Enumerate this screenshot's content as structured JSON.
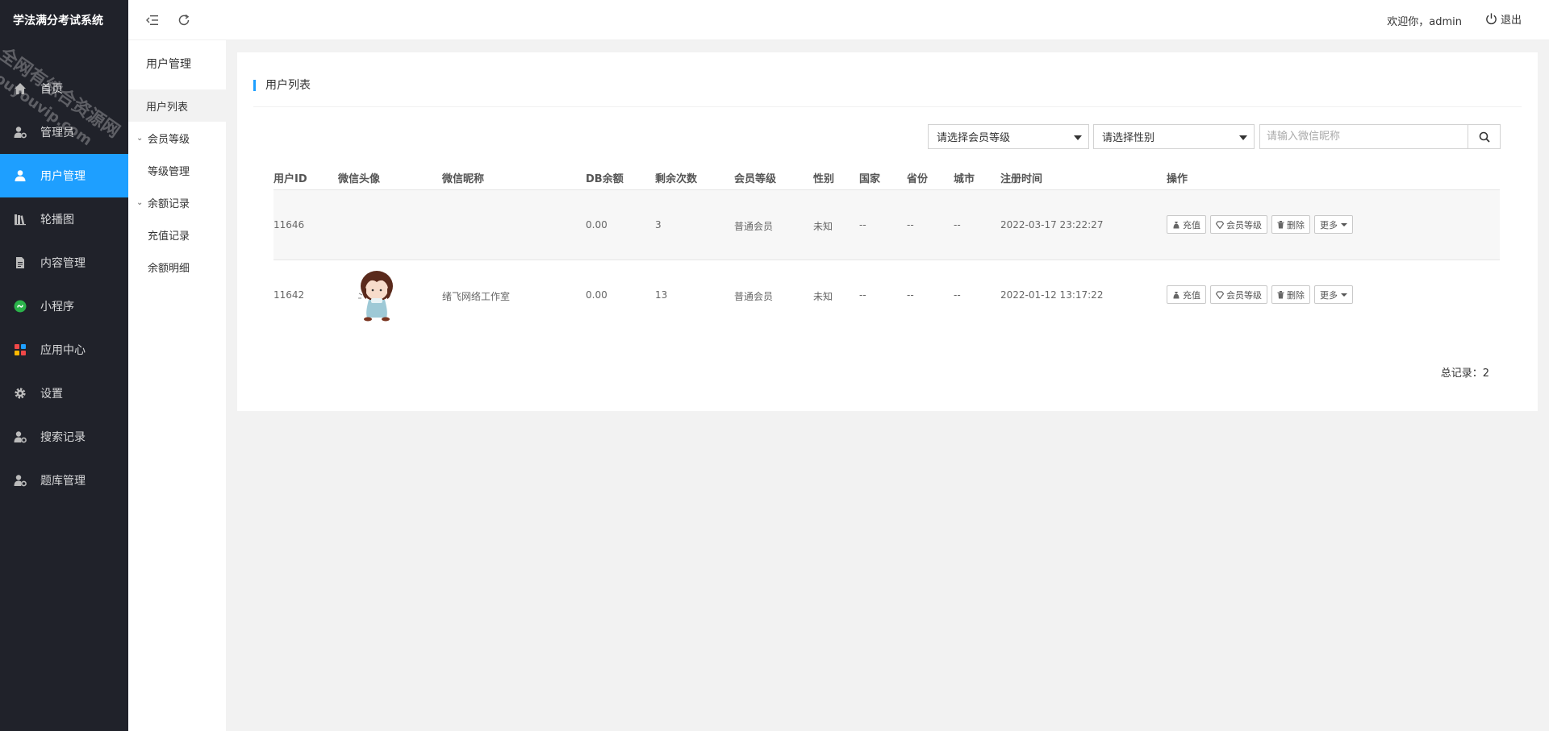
{
  "app": {
    "logo_text": "学法满分考试系统"
  },
  "watermark": {
    "line1": "全网有综合资源网",
    "line2": "douyouvip.com"
  },
  "sidebar": {
    "items": [
      {
        "label": "首页",
        "icon": "home-icon"
      },
      {
        "label": "管理员",
        "icon": "user-gear-icon"
      },
      {
        "label": "用户管理",
        "icon": "user-icon",
        "active": true
      },
      {
        "label": "轮播图",
        "icon": "carousel-icon"
      },
      {
        "label": "内容管理",
        "icon": "document-icon"
      },
      {
        "label": "小程序",
        "icon": "mini-program-icon"
      },
      {
        "label": "应用中心",
        "icon": "apps-icon"
      },
      {
        "label": "设置",
        "icon": "gear-icon"
      },
      {
        "label": "搜索记录",
        "icon": "user-gear-icon"
      },
      {
        "label": "题库管理",
        "icon": "user-gear-icon"
      }
    ]
  },
  "submenu": {
    "title": "用户管理",
    "items": [
      {
        "label": "用户列表",
        "active": true
      },
      {
        "label": "会员等级",
        "group": true
      },
      {
        "label": "等级管理"
      },
      {
        "label": "余额记录",
        "group": true
      },
      {
        "label": "充值记录"
      },
      {
        "label": "余额明细"
      }
    ]
  },
  "header": {
    "welcome": "欢迎你，admin",
    "logout": "退出"
  },
  "card": {
    "title": "用户列表",
    "filters": {
      "level_select": "请选择会员等级",
      "gender_select": "请选择性别",
      "search_placeholder": "请输入微信昵称"
    }
  },
  "table": {
    "columns": [
      "用户ID",
      "微信头像",
      "微信昵称",
      "DB余额",
      "剩余次数",
      "会员等级",
      "性别",
      "国家",
      "省份",
      "城市",
      "注册时间",
      "操作"
    ],
    "rows": [
      {
        "id": "11646",
        "nickname": "",
        "balance": "0.00",
        "remaining": "3",
        "level": "普通会员",
        "gender": "未知",
        "country": "--",
        "province": "--",
        "city": "--",
        "registered": "2022-03-17 23:22:27",
        "has_avatar": false
      },
      {
        "id": "11642",
        "nickname": "绪飞网络工作室",
        "balance": "0.00",
        "remaining": "13",
        "level": "普通会员",
        "gender": "未知",
        "country": "--",
        "province": "--",
        "city": "--",
        "registered": "2022-01-12 13:17:22",
        "has_avatar": true
      }
    ],
    "actions": {
      "recharge": "充值",
      "member_level": "会员等级",
      "delete": "删除",
      "more": "更多"
    }
  },
  "footer": {
    "total": "总记录：2"
  },
  "colors": {
    "accent": "#1e9fff",
    "sidebar_bg": "#20222a"
  }
}
